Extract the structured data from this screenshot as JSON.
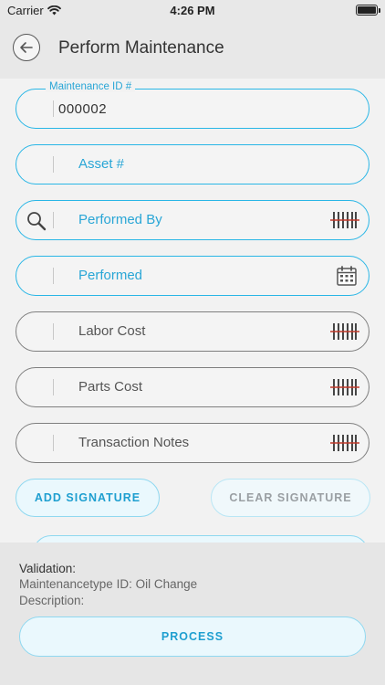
{
  "status_bar": {
    "carrier": "Carrier",
    "time": "4:26 PM"
  },
  "nav": {
    "title": "Perform Maintenance",
    "back_icon": "back-arrow-icon"
  },
  "fields": {
    "maintenance_id": {
      "label": "Maintenance ID #",
      "value": "000002"
    },
    "asset": {
      "label": "Asset #"
    },
    "performed_by": {
      "label": "Performed By",
      "left_icon": "search-icon",
      "right_icon": "barcode-icon"
    },
    "performed": {
      "label": "Performed",
      "right_icon": "calendar-icon"
    },
    "labor_cost": {
      "label": "Labor Cost",
      "right_icon": "barcode-icon"
    },
    "parts_cost": {
      "label": "Parts Cost",
      "right_icon": "barcode-icon"
    },
    "transaction_notes": {
      "label": "Transaction Notes",
      "right_icon": "barcode-icon"
    }
  },
  "buttons": {
    "add_signature": "ADD SIGNATURE",
    "clear_signature": "CLEAR SIGNATURE",
    "process": "PROCESS"
  },
  "footer": {
    "validation": "Validation:",
    "maintenance_type": "Maintenancetype ID: Oil Change",
    "description": "Description:"
  },
  "colors": {
    "accent": "#29b6e6",
    "button_text": "#1f9fd0",
    "barcode_strike": "#c0392b"
  }
}
